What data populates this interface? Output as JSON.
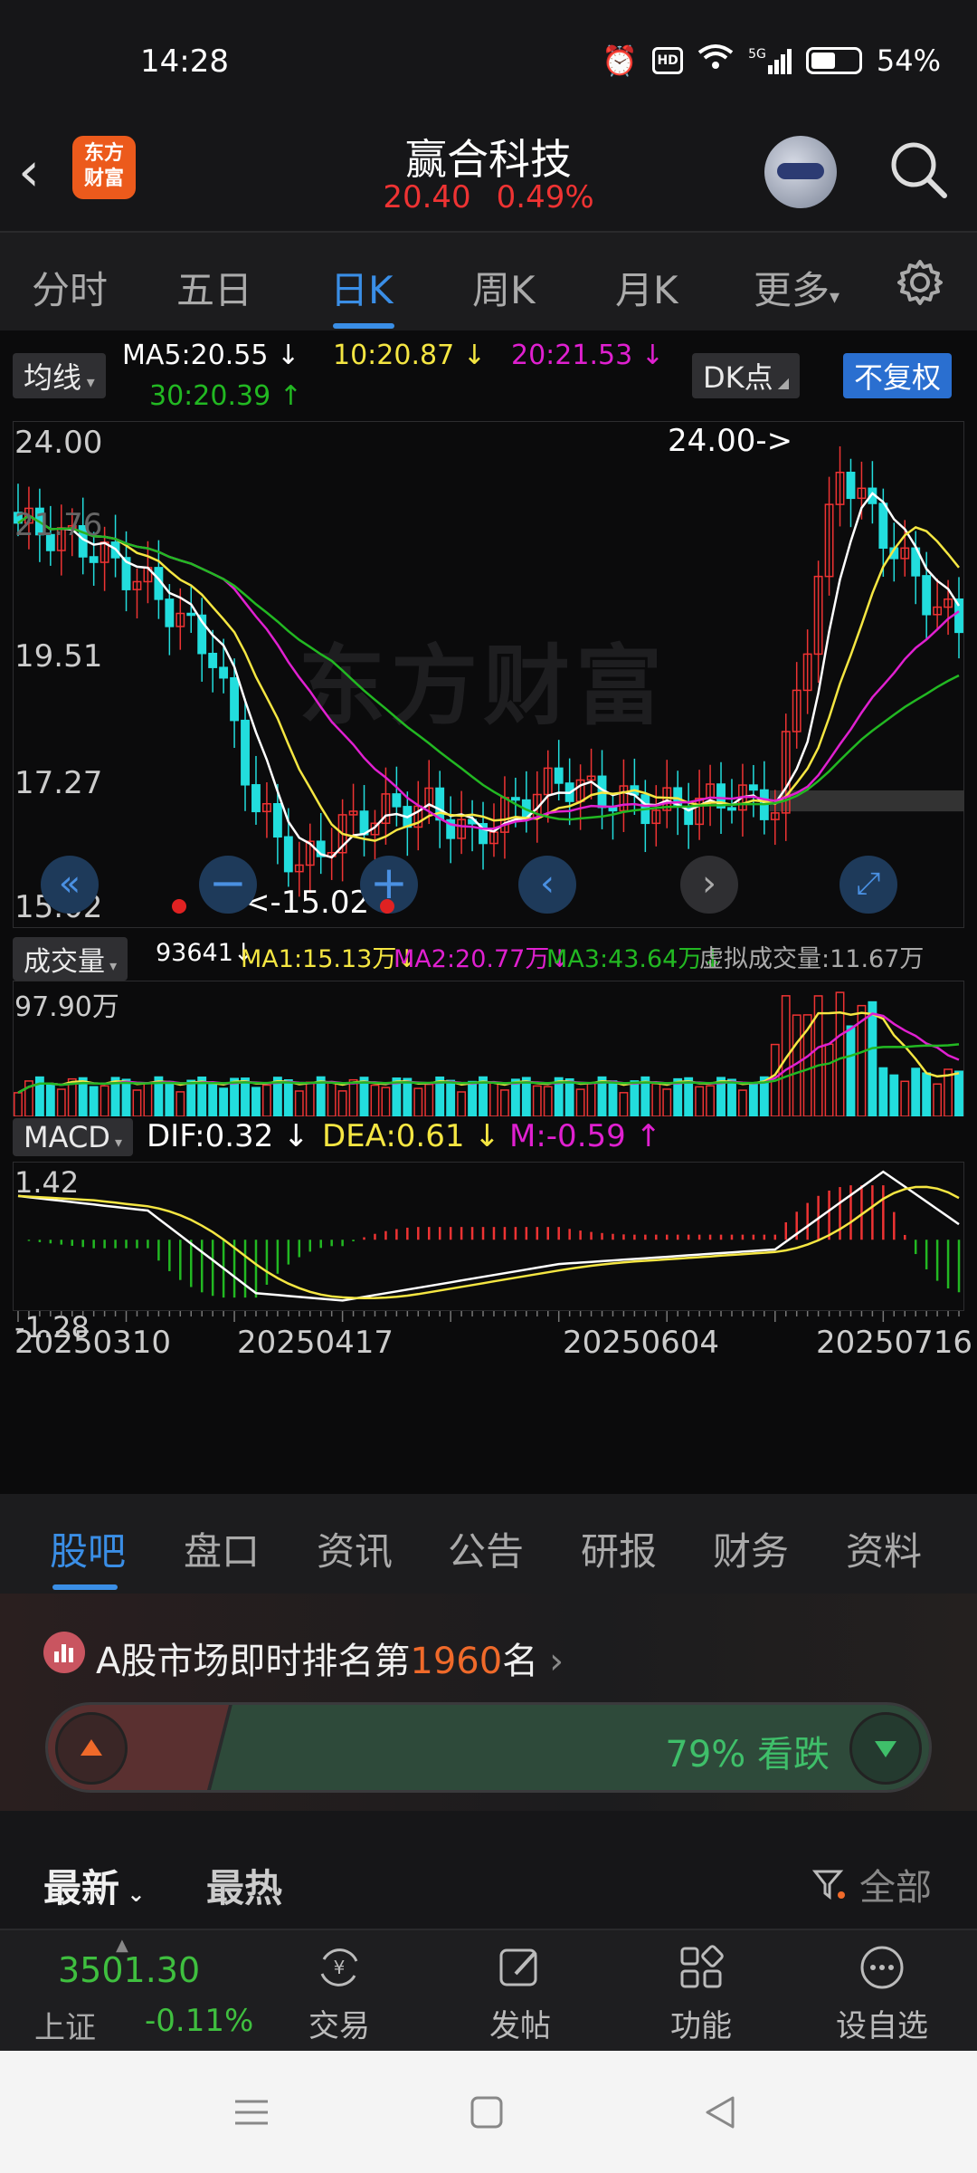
{
  "status": {
    "time": "14:28",
    "battery": "54%",
    "hd": "HD",
    "signal": "5G"
  },
  "header": {
    "logo_line1": "东方",
    "logo_line2": "财富",
    "title": "赢合科技",
    "price": "20.40",
    "change_pct": "0.49%"
  },
  "period_tabs": [
    "分时",
    "五日",
    "日K",
    "周K",
    "月K",
    "更多"
  ],
  "active_period": "日K",
  "chart": {
    "ma_tag": "均线",
    "ma5": "MA5:20.55",
    "ma10": "10:20.87",
    "ma20": "20:21.53",
    "ma30": "30:20.39",
    "dk_button": "DK点",
    "adjust_button": "不复权",
    "y_labels": [
      "24.00",
      "21.76",
      "19.51",
      "17.27",
      "15.02"
    ],
    "high_marker": "24.00->",
    "low_marker": "<-15.02",
    "watermark": "东方财富",
    "vol_tag": "成交量",
    "vol_value": "93641",
    "vol_ma1": "MA1:15.13万",
    "vol_ma2": "MA2:20.77万",
    "vol_ma3": "MA3:43.64万",
    "vol_virtual": "虚拟成交量:11.67万",
    "vol_max": "97.90万",
    "macd_tag": "MACD",
    "dif": "DIF:0.32",
    "dea": "DEA:0.61",
    "m": "M:-0.59",
    "macd_max": "1.42",
    "macd_min": "-1.28",
    "dates": [
      "20250310",
      "20250417",
      "20250604",
      "20250716"
    ]
  },
  "colors": {
    "up": "#ee3333",
    "down": "#22dddd",
    "ma5": "#ffffff",
    "ma10": "#f5e642",
    "ma20": "#e020d0",
    "ma30": "#22b822",
    "accent": "#3a8ee6"
  },
  "info_tabs": [
    "股吧",
    "盘口",
    "资讯",
    "公告",
    "研报",
    "财务",
    "资料"
  ],
  "rank": {
    "prefix": "A股市场即时排名第",
    "number": "1960",
    "suffix": "名"
  },
  "sentiment": {
    "label": "79% 看跌",
    "down_pct": 79
  },
  "sort": {
    "latest": "最新",
    "hot": "最热",
    "filter": "全部"
  },
  "index": {
    "value": "3501.30",
    "name": "上证",
    "change": "-0.11%"
  },
  "bottom_nav": [
    "交易",
    "发帖",
    "功能",
    "设自选"
  ]
}
